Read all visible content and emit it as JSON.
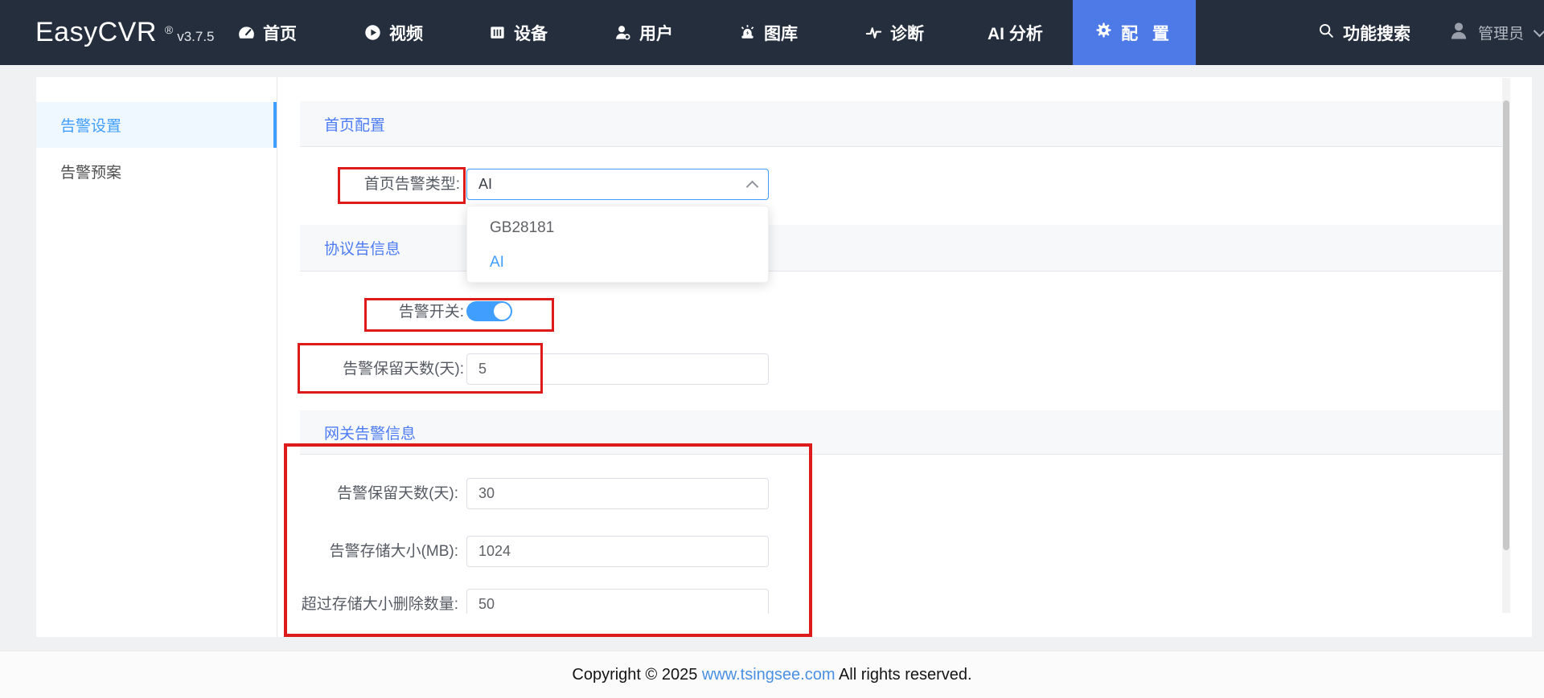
{
  "navbar": {
    "logo": "EasyCVR",
    "registered": "®",
    "version": "v3.7.5",
    "items": [
      {
        "label": "首页",
        "icon": "dashboard-icon"
      },
      {
        "label": "视频",
        "icon": "video-icon"
      },
      {
        "label": "设备",
        "icon": "device-icon"
      },
      {
        "label": "用户",
        "icon": "user-icon"
      },
      {
        "label": "图库",
        "icon": "gallery-icon"
      },
      {
        "label": "诊断",
        "icon": "diagnosis-icon"
      },
      {
        "label": "AI 分析",
        "icon": "none"
      }
    ],
    "config_tab": {
      "label": "配 置",
      "icon": "gear-icon",
      "active": true
    },
    "search_label": "功能搜索",
    "user_label": "管理员"
  },
  "sidebar": {
    "items": [
      {
        "label": "告警设置",
        "active": true
      },
      {
        "label": "告警预案",
        "active": false
      }
    ]
  },
  "home_section": {
    "title": "首页配置",
    "alarm_type_label": "首页告警类型:",
    "alarm_type_value": "AI",
    "dropdown_options": [
      "GB28181",
      "AI"
    ],
    "dropdown_selected": "AI"
  },
  "protocol_section": {
    "title": "协议告信息",
    "switch_label": "告警开关:",
    "switch_state": "on",
    "retention_label": "告警保留天数(天):",
    "retention_value": "5"
  },
  "gateway_section": {
    "title": "网关告警信息",
    "retention_label": "告警保留天数(天):",
    "retention_value": "30",
    "storage_label": "告警存储大小(MB):",
    "storage_value": "1024",
    "delete_label": "超过存储大小删除数量:",
    "delete_value": "50"
  },
  "footer": {
    "copyright_prefix": "Copyright © 2025 ",
    "link": "www.tsingsee.com",
    "copyright_suffix": " All rights reserved."
  },
  "colors": {
    "navbar_bg": "#252e3d",
    "active_tab_bg": "#4e7ae8",
    "primary_blue": "#409eff",
    "section_title_blue": "#4c7bf4",
    "annotation_red": "#dd1b1b",
    "link_blue": "#4a90e2"
  }
}
